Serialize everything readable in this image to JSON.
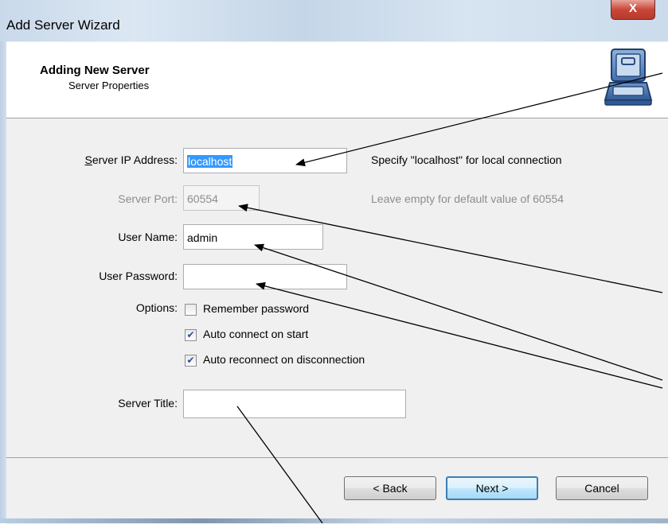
{
  "window": {
    "title": "Add Server Wizard",
    "close_label": "X"
  },
  "header": {
    "title": "Adding New Server",
    "subtitle": "Server Properties"
  },
  "form": {
    "ip_label": "Server IP Address:",
    "ip_value": "localhost",
    "ip_hint": "Specify \"localhost\" for local connection",
    "port_label": "Server Port:",
    "port_value": "60554",
    "port_hint": "Leave empty for default value of 60554",
    "user_label": "User Name:",
    "user_value": "admin",
    "password_label": "User Password:",
    "password_value": "",
    "options_label": "Options:",
    "options": [
      {
        "label": "Remember password",
        "checked": false
      },
      {
        "label": "Auto connect on start",
        "checked": true
      },
      {
        "label": "Auto reconnect on disconnection",
        "checked": true
      }
    ],
    "title_label": "Server Title:",
    "title_value": ""
  },
  "buttons": {
    "back": "< Back",
    "next": "Next >",
    "cancel": "Cancel"
  },
  "colors": {
    "selection": "#3399ff",
    "close_red": "#c8483a",
    "default_button_border": "#3c7fb1"
  }
}
